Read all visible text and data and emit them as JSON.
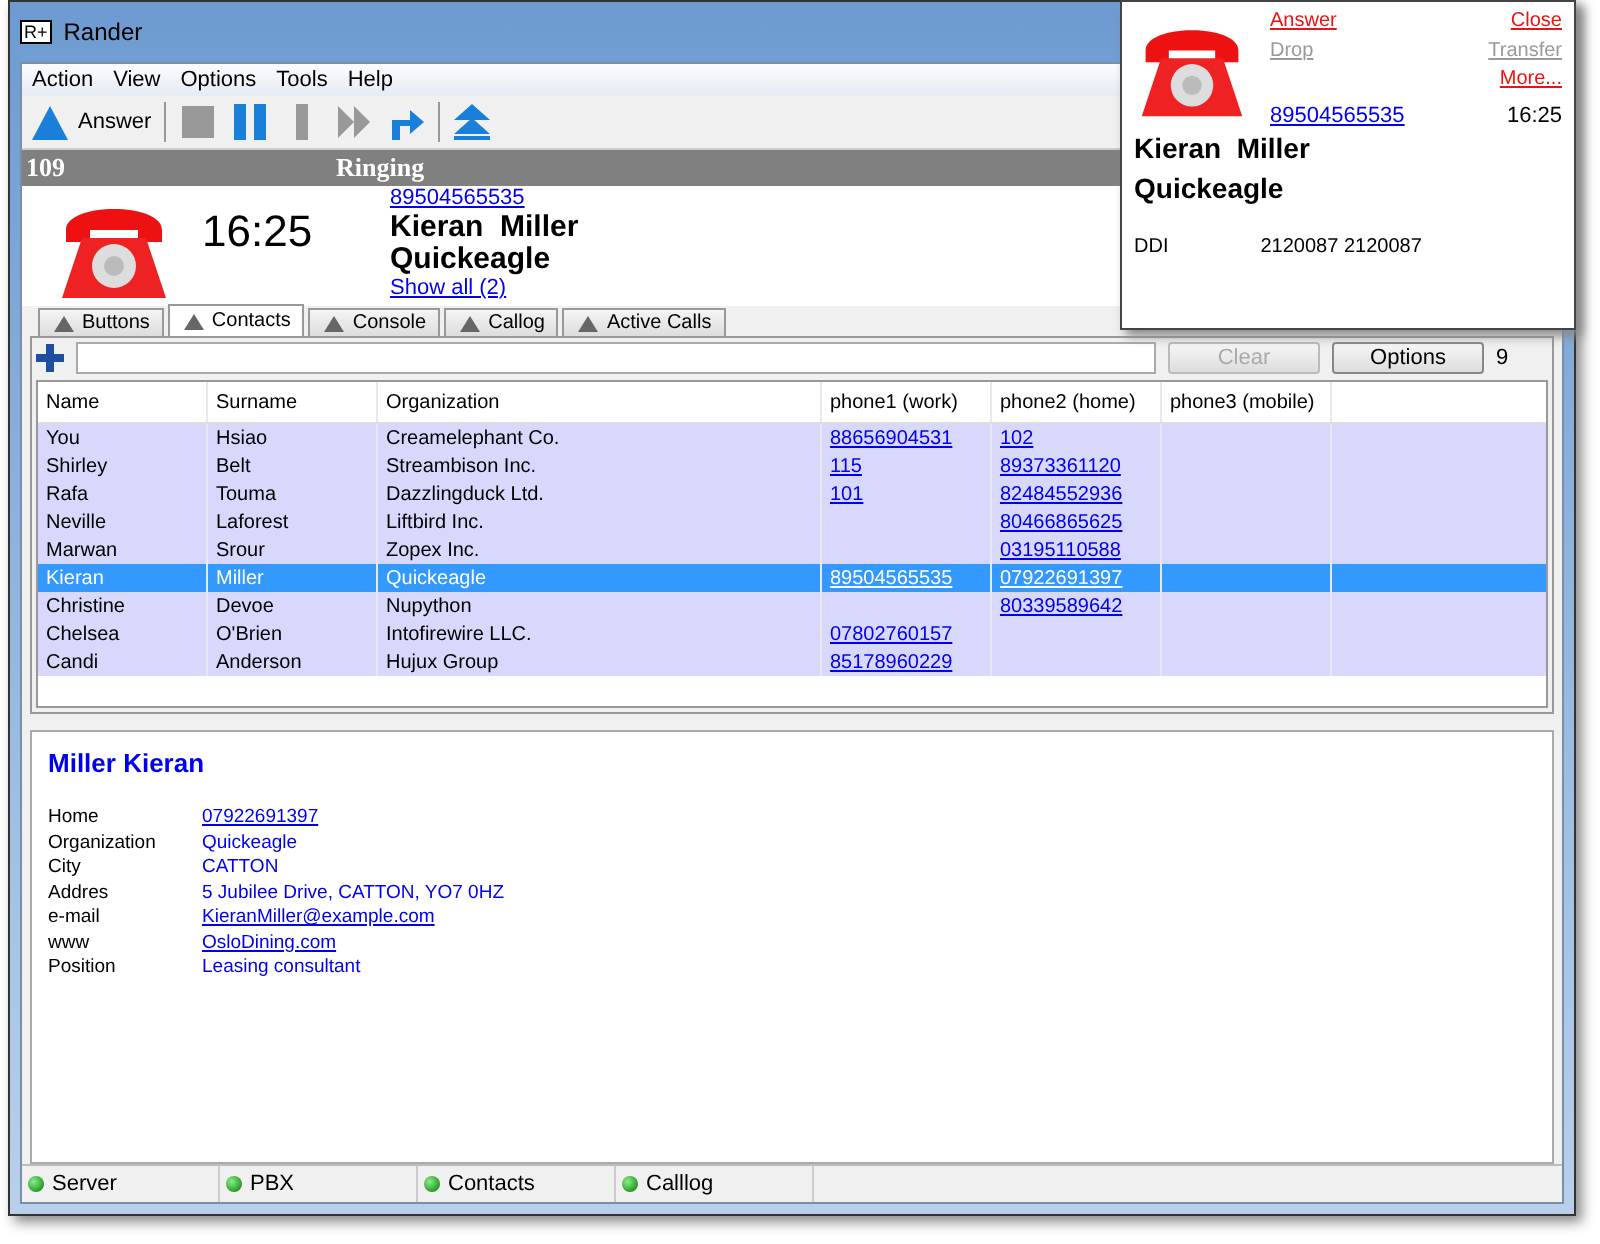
{
  "window": {
    "title": "Rander",
    "logo": "R+"
  },
  "menu": [
    "Action",
    "View",
    "Options",
    "Tools",
    "Help"
  ],
  "toolbar": [
    {
      "kind": "answer",
      "label": "Answer",
      "disabled": false
    },
    {
      "kind": "stop",
      "disabled": true
    },
    {
      "kind": "pause",
      "disabled": false
    },
    {
      "kind": "bar",
      "disabled": true
    },
    {
      "kind": "forward",
      "disabled": true
    },
    {
      "kind": "redirect",
      "disabled": false
    },
    {
      "kind": "up",
      "disabled": false
    }
  ],
  "call": {
    "line": "109",
    "status": "Ringing",
    "time": "16:25",
    "number": "89504565535",
    "name": "Kieran  Miller",
    "company": "Quickeagle",
    "show_all": "Show all (2)"
  },
  "tabs": [
    {
      "label": "Buttons",
      "selected": false
    },
    {
      "label": "Contacts",
      "selected": true
    },
    {
      "label": "Console",
      "selected": false
    },
    {
      "label": "Callog",
      "selected": false
    },
    {
      "label": "Active Calls",
      "selected": false
    }
  ],
  "contacts": {
    "clear": {
      "label": "Clear",
      "disabled": true
    },
    "options": "Options",
    "count": "9",
    "columns": [
      "Name",
      "Surname",
      "Organization",
      "phone1 (work)",
      "phone2 (home)",
      "phone3 (mobile)"
    ],
    "rows": [
      {
        "selected": false,
        "cells": [
          "You",
          "Hsiao",
          "Creamelephant Co.",
          "88656904531",
          "102",
          ""
        ]
      },
      {
        "selected": false,
        "cells": [
          "Shirley",
          "Belt",
          "Streambison Inc.",
          "115",
          "89373361120",
          ""
        ]
      },
      {
        "selected": false,
        "cells": [
          "Rafa",
          "Touma",
          "Dazzlingduck Ltd.",
          "101",
          "82484552936",
          ""
        ]
      },
      {
        "selected": false,
        "cells": [
          "Neville",
          "Laforest",
          "Liftbird Inc.",
          "",
          "80466865625",
          ""
        ]
      },
      {
        "selected": false,
        "cells": [
          "Marwan",
          "Srour",
          "Zopex Inc.",
          "",
          "03195110588",
          ""
        ]
      },
      {
        "selected": true,
        "cells": [
          "Kieran",
          "Miller",
          "Quickeagle",
          "89504565535",
          "07922691397",
          ""
        ]
      },
      {
        "selected": false,
        "cells": [
          "Christine",
          "Devoe",
          "Nupython",
          "",
          "80339589642",
          ""
        ]
      },
      {
        "selected": false,
        "cells": [
          "Chelsea",
          "O'Brien",
          "Intofirewire LLC.",
          "07802760157",
          "",
          ""
        ]
      },
      {
        "selected": false,
        "cells": [
          "Candi",
          "Anderson",
          "Hujux Group",
          "85178960229",
          "",
          ""
        ]
      }
    ]
  },
  "detail": {
    "title": "Miller Kieran",
    "fields": [
      {
        "label": "Home",
        "value": "07922691397",
        "kind": "link"
      },
      {
        "label": "Organization",
        "value": "Quickeagle",
        "kind": "text"
      },
      {
        "label": "City",
        "value": "CATTON",
        "kind": "text"
      },
      {
        "label": "Addres",
        "value": "5 Jubilee Drive, CATTON, YO7 0HZ",
        "kind": "text"
      },
      {
        "label": "e-mail",
        "value": "KieranMiller@example.com",
        "kind": "link"
      },
      {
        "label": "www",
        "value": "OsloDining.com",
        "kind": "link"
      },
      {
        "label": "Position",
        "value": "Leasing consultant",
        "kind": "text"
      }
    ]
  },
  "status_bar": [
    "Server",
    "PBX",
    "Contacts",
    "Calllog"
  ],
  "popup": {
    "links": [
      {
        "label": "Answer",
        "disabled": false
      },
      {
        "label": "Close",
        "disabled": false
      },
      {
        "label": "Drop",
        "disabled": true
      },
      {
        "label": "Transfer",
        "disabled": true
      },
      {
        "label": "More...",
        "disabled": false
      }
    ],
    "number": "89504565535",
    "time": "16:25",
    "name": "Kieran  Miller",
    "company": "Quickeagle",
    "ddi_label": "DDI",
    "ddi_value": "2120087 2120087"
  }
}
